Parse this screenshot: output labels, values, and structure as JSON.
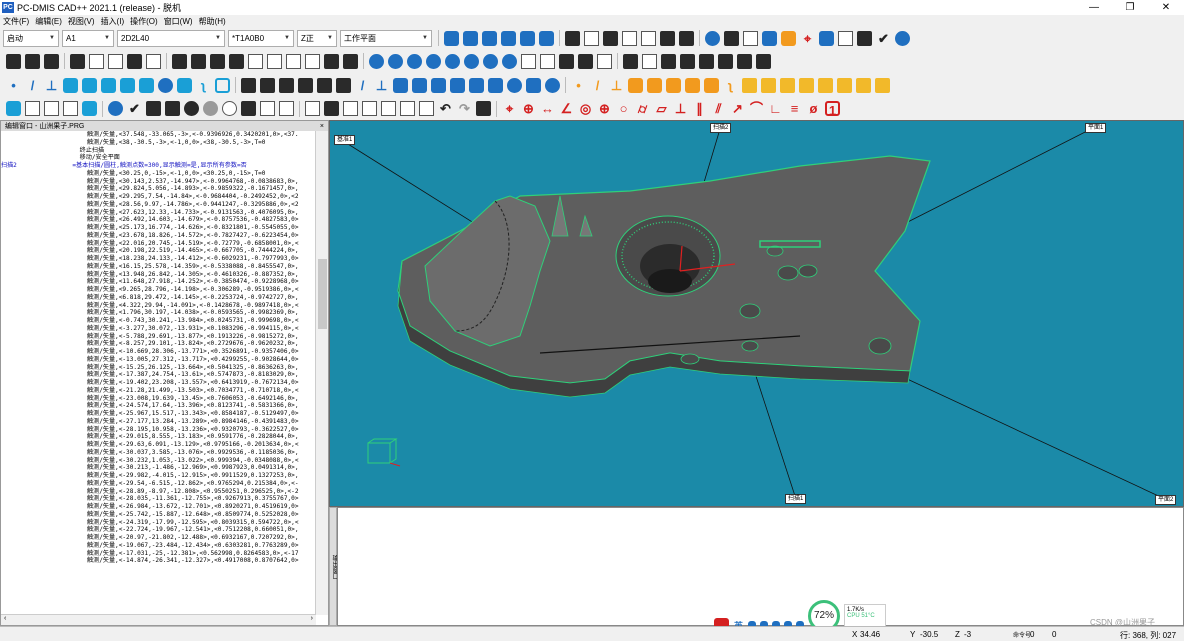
{
  "window": {
    "title": "PC-DMIS CAD++ 2021.1 (release) - 脱机",
    "app_icon_text": "PC",
    "minimize": "—",
    "restore": "❐",
    "close": "✕"
  },
  "menu": [
    "文件(F)",
    "编辑(E)",
    "视图(V)",
    "插入(I)",
    "操作(O)",
    "窗口(W)",
    "帮助(H)"
  ],
  "toolbar": {
    "combos": [
      {
        "value": "启动"
      },
      {
        "value": "A1"
      },
      {
        "value": "2D2L40"
      },
      {
        "value": "*T1A0B0"
      },
      {
        "value": "Z正"
      },
      {
        "value": "工作平面"
      }
    ]
  },
  "edit_window": {
    "title": "编辑窗口 - 山洲果子.PRG",
    "close": "×",
    "scroll_left": "‹",
    "scroll_right": "›",
    "lines": [
      {
        "label": "",
        "text": "      触测/矢量,<37.548,-33.065,-3>,<-0.9396926,0.3420201,0>,<37.",
        "cls": "blk"
      },
      {
        "label": "",
        "text": "      触测/矢量,<38,-30.5,-3>,<-1,0,0>,<38,-30.5,-3>,T=0",
        "cls": "blk"
      },
      {
        "label": "",
        "text": "    终止扫描",
        "cls": "blk"
      },
      {
        "label": "",
        "text": "    移动/安全平面",
        "cls": "blk"
      },
      {
        "label": "扫描2",
        "text": "  =基本扫描/圆柱,触测点数=300,显示触测=是,显示所有参数=否",
        "cls": "cmd"
      },
      {
        "label": "",
        "text": "      触测/矢量,<30.25,0,-15>,<-1,0,0>,<30.25,0,-15>,T=0",
        "cls": "blk"
      },
      {
        "label": "",
        "text": "      触测/矢量,<30.143,2.537,-14.947>,<-0.9964768,-0.0838683,0>,",
        "cls": "blk"
      },
      {
        "label": "",
        "text": "      触测/矢量,<29.824,5.056,-14.893>,<-0.9859322,-0.1671457,0>,",
        "cls": "blk"
      },
      {
        "label": "",
        "text": "      触测/矢量,<29.295,7.54,-14.84>,<-0.9684404,-0.2492452,0>,<2",
        "cls": "blk"
      },
      {
        "label": "",
        "text": "      触测/矢量,<28.56,9.97,-14.786>,<-0.9441247,-0.3295886,0>,<2",
        "cls": "blk"
      },
      {
        "label": "",
        "text": "      触测/矢量,<27.623,12.33,-14.733>,<-0.9131563,-0.4076095,0>,",
        "cls": "blk"
      },
      {
        "label": "",
        "text": "      触测/矢量,<26.492,14.603,-14.679>,<-0.8757536,-0.4827583,0>",
        "cls": "blk"
      },
      {
        "label": "",
        "text": "      触测/矢量,<25.173,16.774,-14.626>,<-0.8321801,-0.5545055,0>",
        "cls": "blk"
      },
      {
        "label": "",
        "text": "      触测/矢量,<23.678,18.826,-14.572>,<-0.7827427,-0.6223454,0>",
        "cls": "blk"
      },
      {
        "label": "",
        "text": "      触测/矢量,<22.016,20.745,-14.519>,<-0.72779,-0.6858001,0>,<",
        "cls": "blk"
      },
      {
        "label": "",
        "text": "      触测/矢量,<20.198,22.519,-14.465>,<-0.667705,-0.7444224,0>,",
        "cls": "blk"
      },
      {
        "label": "",
        "text": "      触测/矢量,<18.238,24.133,-14.412>,<-0.6029231,-0.7977993,0>",
        "cls": "blk"
      },
      {
        "label": "",
        "text": "      触测/矢量,<16.15,25.578,-14.359>,<-0.5338088,-0.8455547,0>,",
        "cls": "blk"
      },
      {
        "label": "",
        "text": "      触测/矢量,<13.948,26.842,-14.305>,<-0.4610326,-0.887352,0>,",
        "cls": "blk"
      },
      {
        "label": "",
        "text": "      触测/矢量,<11.648,27.918,-14.252>,<-0.3850474,-0.9228968,0>",
        "cls": "blk"
      },
      {
        "label": "",
        "text": "      触测/矢量,<9.265,28.796,-14.198>,<-0.306289,-0.9519386,0>,<",
        "cls": "blk"
      },
      {
        "label": "",
        "text": "      触测/矢量,<6.818,29.472,-14.145>,<-0.2253724,-0.9742727,0>,",
        "cls": "blk"
      },
      {
        "label": "",
        "text": "      触测/矢量,<4.322,29.94,-14.091>,<-0.1428678,-0.9897418,0>,<",
        "cls": "blk"
      },
      {
        "label": "",
        "text": "      触测/矢量,<1.796,30.197,-14.038>,<-0.0593565,-0.9982369,0>,",
        "cls": "blk"
      },
      {
        "label": "",
        "text": "      触测/矢量,<-0.743,30.241,-13.984>,<0.0245731,-0.999698,0>,<",
        "cls": "blk"
      },
      {
        "label": "",
        "text": "      触测/矢量,<-3.277,30.072,-13.931>,<0.1083296,-0.994115,0>,<",
        "cls": "blk"
      },
      {
        "label": "",
        "text": "      触测/矢量,<-5.788,29.691,-13.877>,<0.1913226,-0.9815272,0>,",
        "cls": "blk"
      },
      {
        "label": "",
        "text": "      触测/矢量,<-8.257,29.101,-13.824>,<0.2729676,-0.9620232,0>,",
        "cls": "blk"
      },
      {
        "label": "",
        "text": "      触测/矢量,<-10.669,28.306,-13.771>,<0.3526891,-0.9357406,0>",
        "cls": "blk"
      },
      {
        "label": "",
        "text": "      触测/矢量,<-13.005,27.312,-13.717>,<0.4299255,-0.9028644,0>",
        "cls": "blk"
      },
      {
        "label": "",
        "text": "      触测/矢量,<-15.25,26.125,-13.664>,<0.5041325,-0.8636263,0>,",
        "cls": "blk"
      },
      {
        "label": "",
        "text": "      触测/矢量,<-17.387,24.754,-13.61>,<0.5747873,-0.8183029,0>,",
        "cls": "blk"
      },
      {
        "label": "",
        "text": "      触测/矢量,<-19.402,23.208,-13.557>,<0.6413919,-0.7672134,0>",
        "cls": "blk"
      },
      {
        "label": "",
        "text": "      触测/矢量,<-21.28,21.499,-13.503>,<0.7034771,-0.710718,0>,<",
        "cls": "blk"
      },
      {
        "label": "",
        "text": "      触测/矢量,<-23.008,19.639,-13.45>,<0.7606053,-0.6492146,0>,",
        "cls": "blk"
      },
      {
        "label": "",
        "text": "      触测/矢量,<-24.574,17.64,-13.396>,<0.8123741,-0.5831366,0>,",
        "cls": "blk"
      },
      {
        "label": "",
        "text": "      触测/矢量,<-25.967,15.517,-13.343>,<0.8584187,-0.5129497,0>",
        "cls": "blk"
      },
      {
        "label": "",
        "text": "      触测/矢量,<-27.177,13.284,-13.289>,<0.8984146,-0.4391483,0>",
        "cls": "blk"
      },
      {
        "label": "",
        "text": "      触测/矢量,<-28.195,10.958,-13.236>,<0.9320793,-0.3622527,0>",
        "cls": "blk"
      },
      {
        "label": "",
        "text": "      触测/矢量,<-29.015,8.555,-13.183>,<0.9591776,-0.2828044,0>,",
        "cls": "blk"
      },
      {
        "label": "",
        "text": "      触测/矢量,<-29.63,6.091,-13.129>,<0.9795166,-0.2013634,0>,<",
        "cls": "blk"
      },
      {
        "label": "",
        "text": "      触测/矢量,<-30.037,3.585,-13.076>,<0.9929536,-0.1185036,0>,",
        "cls": "blk"
      },
      {
        "label": "",
        "text": "      触测/矢量,<-30.232,1.053,-13.022>,<0.999394,-0.0348088,0>,<",
        "cls": "blk"
      },
      {
        "label": "",
        "text": "      触测/矢量,<-30.213,-1.486,-12.969>,<0.9987923,0.0491314,0>,",
        "cls": "blk"
      },
      {
        "label": "",
        "text": "      触测/矢量,<-29.982,-4.015,-12.915>,<0.9911529,0.1327253,0>,",
        "cls": "blk"
      },
      {
        "label": "",
        "text": "      触测/矢量,<-29.54,-6.515,-12.862>,<0.9765294,0.215384,0>,<-",
        "cls": "blk"
      },
      {
        "label": "",
        "text": "      触测/矢量,<-28.89,-8.97,-12.808>,<0.9550251,0.296525,0>,<-2",
        "cls": "blk"
      },
      {
        "label": "",
        "text": "      触测/矢量,<-28.035,-11.361,-12.755>,<0.9267913,0.3755767,0>",
        "cls": "blk"
      },
      {
        "label": "",
        "text": "      触测/矢量,<-26.984,-13.672,-12.701>,<0.8920271,0.4519619,0>",
        "cls": "blk"
      },
      {
        "label": "",
        "text": "      触测/矢量,<-25.742,-15.887,-12.648>,<0.8509774,0.5252028,0>",
        "cls": "blk"
      },
      {
        "label": "",
        "text": "      触测/矢量,<-24.319,-17.99,-12.595>,<0.8039315,0.594722,0>,<",
        "cls": "blk"
      },
      {
        "label": "",
        "text": "      触测/矢量,<-22.724,-19.967,-12.541>,<0.7512208,0.660051,0>,",
        "cls": "blk"
      },
      {
        "label": "",
        "text": "      触测/矢量,<-20.97,-21.802,-12.488>,<0.6932167,0.7207292,0>,",
        "cls": "blk"
      },
      {
        "label": "",
        "text": "      触测/矢量,<-19.067,-23.484,-12.434>,<0.6303281,0.7763289,0>",
        "cls": "blk"
      },
      {
        "label": "",
        "text": "      触测/矢量,<-17.031,-25,-12.381>,<0.562998,0.8264583,0>,<-17",
        "cls": "blk"
      },
      {
        "label": "",
        "text": "      触测/矢量,<-14.874,-26.341,-12.327>,<0.4917008,0.8707642,0>",
        "cls": "blk"
      }
    ]
  },
  "viewport": {
    "labels": [
      "基准1",
      "扫描2",
      "平面1",
      "扫描1",
      "平面2"
    ],
    "background": "#1b8aa8",
    "part_color": "#5e5e5e",
    "highlight_color": "#2fd07a"
  },
  "output_window": {
    "tab": "输出窗口"
  },
  "status": {
    "x_label": "X",
    "x_value": "34.46",
    "y_label": "Y",
    "y_value": "-30.5",
    "z_label": "Z",
    "z_value": "-3",
    "cmd_label": "命令号",
    "cmd_value": "0",
    "line_value": "0",
    "line_info": "行: 368, 列: 027"
  },
  "tray": {
    "ime": "英",
    "cpu_percent": "72%",
    "net": "1.7K/s",
    "cpu_temp": "CPU 51°C"
  },
  "watermark": "CSDN @山洲果子"
}
